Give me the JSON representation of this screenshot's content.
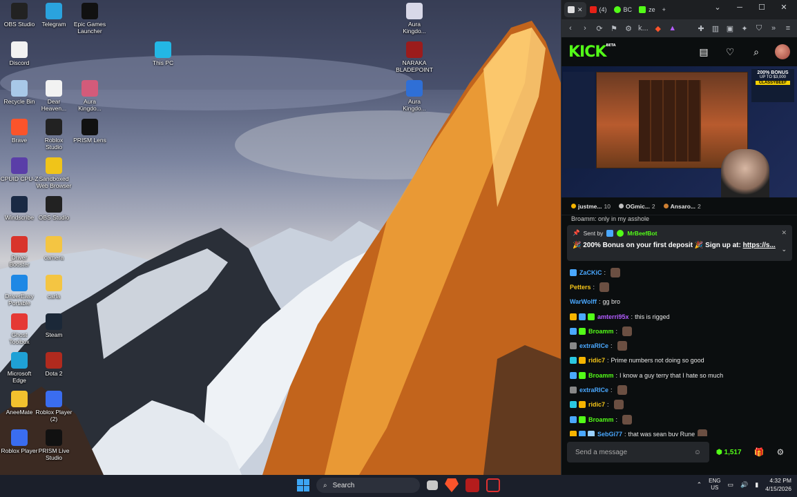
{
  "desktop": {
    "icons": [
      {
        "label": "OBS Studio",
        "icon": "obs-icon",
        "color": "#222"
      },
      {
        "label": "Telegram",
        "icon": "telegram-icon",
        "color": "#2aa3de"
      },
      {
        "label": "Epic Games\nLauncher",
        "icon": "epic-games-icon",
        "color": "#111"
      },
      {
        "label": "Discord",
        "icon": "file-icon",
        "color": "#f2f2f2"
      },
      {
        "label": "This PC",
        "icon": "this-pc-icon",
        "color": "#23b7e5"
      },
      {
        "label": "Recycle Bin",
        "icon": "recycle-bin-icon",
        "color": "#a8c8e8"
      },
      {
        "label": "Dear\nHeaven...",
        "icon": "document-icon",
        "color": "#f2f2f2"
      },
      {
        "label": "Aura\nKingdo...",
        "icon": "aura-kingdom-icon",
        "color": "#d35b7a"
      },
      {
        "label": "Brave",
        "icon": "brave-icon",
        "color": "#fb542b"
      },
      {
        "label": "Roblox\nStudio",
        "icon": "roblox-studio-icon",
        "color": "#222"
      },
      {
        "label": "PRISM Lens",
        "icon": "prism-lens-icon",
        "color": "#111"
      },
      {
        "label": "CPUID CPU-Z",
        "icon": "cpuz-icon",
        "color": "#5a3ea8"
      },
      {
        "label": "Sandboxed\nWeb Browser",
        "icon": "sandboxed-browser-icon",
        "color": "#f0c419"
      },
      {
        "label": "Windscribe",
        "icon": "windscribe-icon",
        "color": "#1a2a44"
      },
      {
        "label": "OBS Studio",
        "icon": "obs-icon",
        "color": "#222"
      },
      {
        "label": "Driver\nBooster",
        "icon": "driver-booster-icon",
        "color": "#d9342b"
      },
      {
        "label": "camera",
        "icon": "folder-icon",
        "color": "#f4c542"
      },
      {
        "label": "DriverEasy\nPortable",
        "icon": "drivereasy-icon",
        "color": "#1e88e5"
      },
      {
        "label": "carla",
        "icon": "folder-icon",
        "color": "#f4c542"
      },
      {
        "label": "Ghost\nToolbox",
        "icon": "ghost-toolbox-icon",
        "color": "#e53935"
      },
      {
        "label": "Steam",
        "icon": "steam-icon",
        "color": "#1b2838"
      },
      {
        "label": "Microsoft\nEdge",
        "icon": "edge-icon",
        "color": "#1fa1d6"
      },
      {
        "label": "Dota 2",
        "icon": "dota2-icon",
        "color": "#b02a1e"
      },
      {
        "label": "AneeMate",
        "icon": "aneemate-icon",
        "color": "#f2c12e"
      },
      {
        "label": "Roblox Player\n(2)",
        "icon": "roblox-player-icon",
        "color": "#3a6df0"
      },
      {
        "label": "Roblox Player",
        "icon": "roblox-player-icon",
        "color": "#3a6df0"
      },
      {
        "label": "PRISM Live\nStudio",
        "icon": "prism-live-icon",
        "color": "#111"
      },
      {
        "label": "Aura\nKingdo...",
        "icon": "aura-kingdom-icon",
        "color": "#d8d8e8"
      },
      {
        "label": "NARAKA\nBLADEPOINT",
        "icon": "naraka-icon",
        "color": "#9b1c1c"
      },
      {
        "label": "Aura\nKingdo...",
        "icon": "aura-kingdom-icon",
        "color": "#2f6fd6"
      }
    ]
  },
  "browser": {
    "tabs": [
      {
        "label": "",
        "icon": "kick-favicon",
        "active": true
      },
      {
        "label": "(4)",
        "icon": "youtube-favicon"
      },
      {
        "label": "BC",
        "icon": "bc-favicon"
      },
      {
        "label": "ze",
        "icon": "kick-favicon"
      }
    ],
    "address": "k...",
    "kick": {
      "logo": "KICK",
      "logo_badge": "BETA",
      "accent": "#53fc18",
      "video": {
        "promo_title": "200% BONUS",
        "promo_sub": "UP TO $3,000",
        "promo_code": "CLASSYBEEF"
      },
      "leaderboard": [
        {
          "name": "justme...",
          "count": "10",
          "color": "#f5b400"
        },
        {
          "name": "OGmic...",
          "count": "2",
          "color": "#c0c0c0"
        },
        {
          "name": "Ansaro...",
          "count": "2",
          "color": "#cd7f32"
        }
      ],
      "pinned": {
        "prev_line": "Broamm: only in my asshole",
        "sent_by": "Sent by",
        "bot": "MrBeefBot",
        "text": "🎉 200% Bonus on your first deposit 🎉 Sign up at: ",
        "link": "https://s..."
      },
      "messages": [
        {
          "user": "ZaCKiC",
          "color": "#4aa8ff",
          "text": "",
          "emote": true,
          "badges": [
            "#4aa8ff"
          ]
        },
        {
          "user": "Petters",
          "color": "#f5c518",
          "text": "",
          "emote": true,
          "badges": []
        },
        {
          "user": "WarWolff",
          "color": "#4aa8ff",
          "text": "gg bro",
          "emote": false,
          "badges": []
        },
        {
          "user": "amterri95x",
          "color": "#b35cff",
          "text": "this is rigged",
          "emote": false,
          "badges": [
            "#f5b400",
            "#4aa8ff",
            "#53fc18"
          ]
        },
        {
          "user": "Broamm",
          "color": "#53fc18",
          "text": "",
          "emote": true,
          "badges": [
            "#4aa8ff",
            "#53fc18"
          ]
        },
        {
          "user": "extraRICe",
          "color": "#4aa8ff",
          "text": "",
          "emote": true,
          "badges": [
            "#888888"
          ]
        },
        {
          "user": "ridic7",
          "color": "#f5c518",
          "text": "Prime numbers not doing so good",
          "emote": false,
          "badges": [
            "#2ac7e0",
            "#f5b400"
          ]
        },
        {
          "user": "Broamm",
          "color": "#53fc18",
          "text": "I know a guy terry that I hate so much",
          "emote": false,
          "badges": [
            "#4aa8ff",
            "#53fc18"
          ]
        },
        {
          "user": "extraRICe",
          "color": "#4aa8ff",
          "text": "",
          "emote": true,
          "badges": [
            "#888888"
          ]
        },
        {
          "user": "ridic7",
          "color": "#f5c518",
          "text": "",
          "emote": true,
          "badges": [
            "#2ac7e0",
            "#f5b400"
          ]
        },
        {
          "user": "Broamm",
          "color": "#53fc18",
          "text": "",
          "emote": true,
          "badges": [
            "#4aa8ff",
            "#53fc18"
          ]
        },
        {
          "user": "SebGi77",
          "color": "#4aa8ff",
          "text": "that was sean buy Rune",
          "emote": true,
          "badges": [
            "#f5b400",
            "#4aa8ff",
            "#9ad0ff"
          ]
        }
      ],
      "input_placeholder": "Send a message",
      "points": "1,517"
    }
  },
  "taskbar": {
    "search_label": "Search",
    "ime_line1": "ENG",
    "ime_line2": "US",
    "time": "4:32 PM",
    "date": "4/15/2026"
  }
}
